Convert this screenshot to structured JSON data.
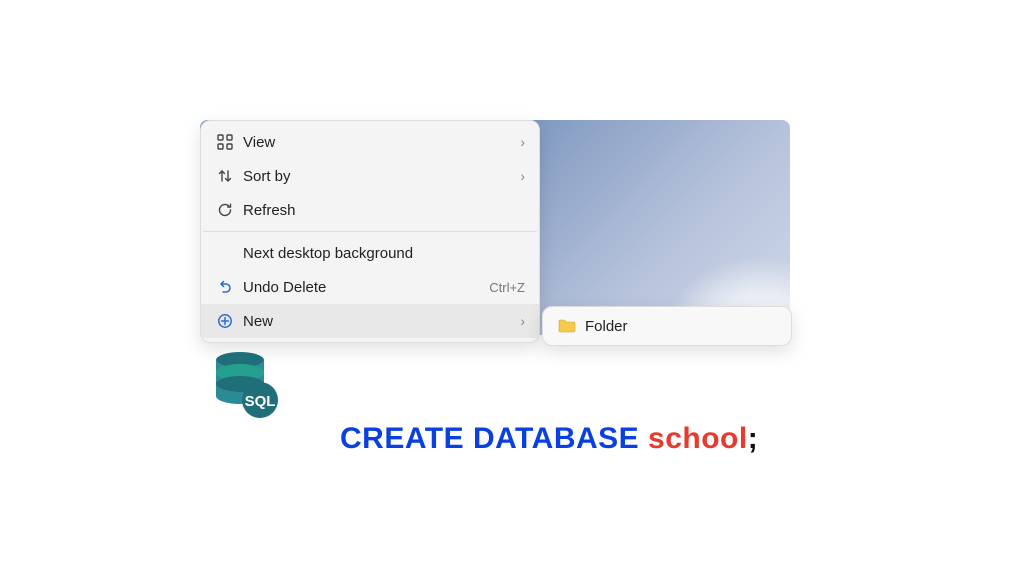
{
  "context_menu": {
    "items": [
      {
        "icon": "grid-icon",
        "label": "View",
        "has_submenu": true,
        "shortcut": ""
      },
      {
        "icon": "sort-icon",
        "label": "Sort by",
        "has_submenu": true,
        "shortcut": ""
      },
      {
        "icon": "refresh-icon",
        "label": "Refresh",
        "has_submenu": false,
        "shortcut": ""
      }
    ],
    "items2": [
      {
        "icon": "",
        "label": "Next desktop background",
        "has_submenu": false,
        "shortcut": ""
      },
      {
        "icon": "undo-icon",
        "label": "Undo Delete",
        "has_submenu": false,
        "shortcut": "Ctrl+Z"
      },
      {
        "icon": "plus-circle-icon",
        "label": "New",
        "has_submenu": true,
        "shortcut": "",
        "hovered": true
      }
    ]
  },
  "submenu": {
    "items": [
      {
        "icon": "folder-icon",
        "label": "Folder"
      }
    ]
  },
  "sql": {
    "keyword": "CREATE DATABASE",
    "identifier": "school",
    "terminator": ";",
    "badge_text": "SQL"
  }
}
